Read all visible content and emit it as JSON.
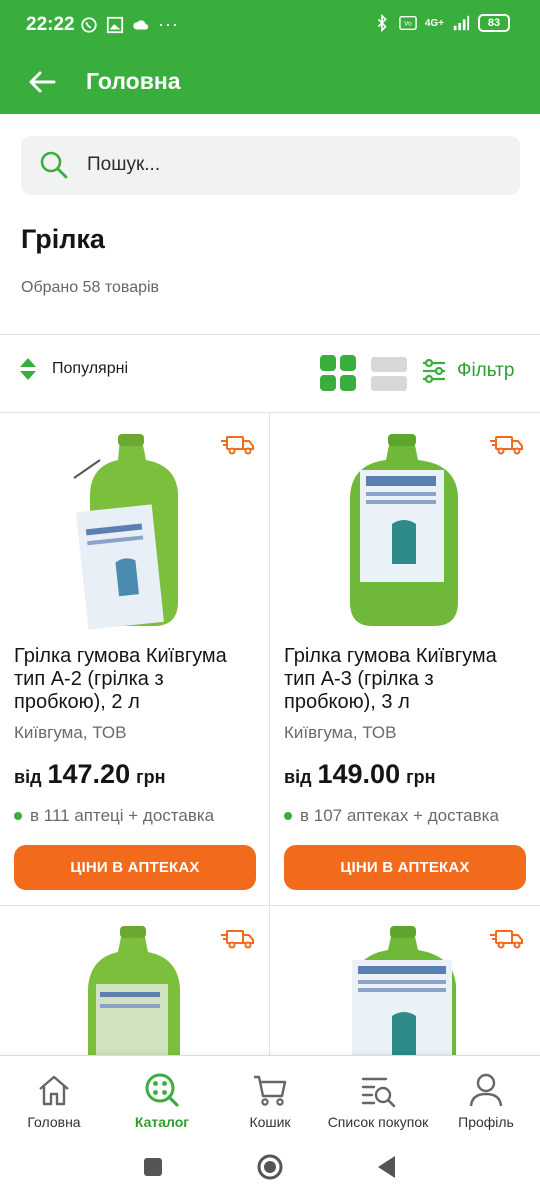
{
  "status_bar": {
    "time": "22:22",
    "battery": "83",
    "network": "4G+"
  },
  "app_bar": {
    "title": "Головна"
  },
  "search": {
    "placeholder": "Пошук..."
  },
  "category": {
    "title": "Грілка",
    "count": "Обрано 58 товарів"
  },
  "toolbar": {
    "sort_label": "Популярні",
    "filter_label": "Фільтр"
  },
  "products": [
    {
      "name": "Грілка гумова Київгума тип А-2 (грілка з пробкою), 2 л",
      "maker": "Київгума, ТОВ",
      "price_prefix": "від",
      "price": "147.20",
      "currency": "грн",
      "availability": "в 111 аптеці + доставка",
      "button": "ЦІНИ В АПТЕКАХ"
    },
    {
      "name": "Грілка гумова Київгума тип А-3 (грілка з пробкою), 3 л",
      "maker": "Київгума, ТОВ",
      "price_prefix": "від",
      "price": "149.00",
      "currency": "грн",
      "availability": "в 107 аптеках + доставка",
      "button": "ЦІНИ В АПТЕКАХ"
    }
  ],
  "bottom_nav": [
    {
      "label": "Головна",
      "icon": "home-icon"
    },
    {
      "label": "Каталог",
      "icon": "catalog-icon",
      "active": true
    },
    {
      "label": "Кошик",
      "icon": "cart-icon"
    },
    {
      "label": "Список покупок",
      "icon": "shopping-list-icon"
    },
    {
      "label": "Профіль",
      "icon": "profile-icon"
    }
  ],
  "colors": {
    "brand_green": "#3aae3d",
    "accent_orange": "#f26a1b"
  }
}
